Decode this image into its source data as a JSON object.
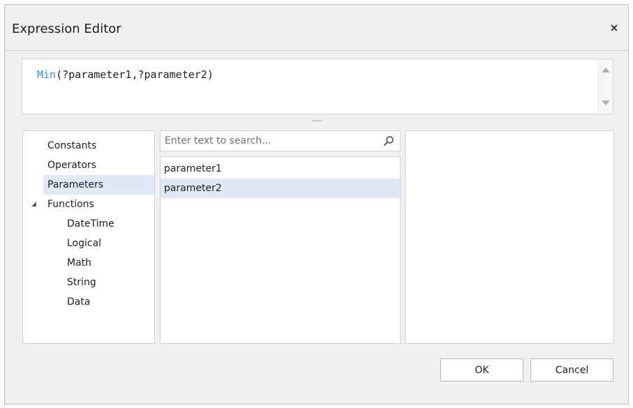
{
  "window": {
    "title": "Expression Editor",
    "close_glyph": "×"
  },
  "editor": {
    "function_name": "Min",
    "arguments": "(?parameter1,?parameter2)"
  },
  "categories": {
    "items": [
      {
        "label": "Constants",
        "selected": false
      },
      {
        "label": "Operators",
        "selected": false
      },
      {
        "label": "Parameters",
        "selected": true
      },
      {
        "label": "Functions",
        "selected": false,
        "expanded": true,
        "expander": "◢"
      },
      {
        "label": "DateTime",
        "selected": false
      },
      {
        "label": "Logical",
        "selected": false
      },
      {
        "label": "Math",
        "selected": false
      },
      {
        "label": "String",
        "selected": false
      },
      {
        "label": "Data",
        "selected": false
      }
    ]
  },
  "search": {
    "placeholder": "Enter text to search...",
    "value": ""
  },
  "list": {
    "items": [
      {
        "label": "parameter1",
        "selected": false
      },
      {
        "label": "parameter2",
        "selected": true
      }
    ]
  },
  "buttons": {
    "ok_label": "OK",
    "cancel_label": "Cancel"
  },
  "colors": {
    "function_keyword": "#3f8fd8",
    "selection": "#dfe8f5"
  },
  "icons": {
    "search": "search-icon",
    "close": "close-icon",
    "expander": "expander-icon"
  }
}
